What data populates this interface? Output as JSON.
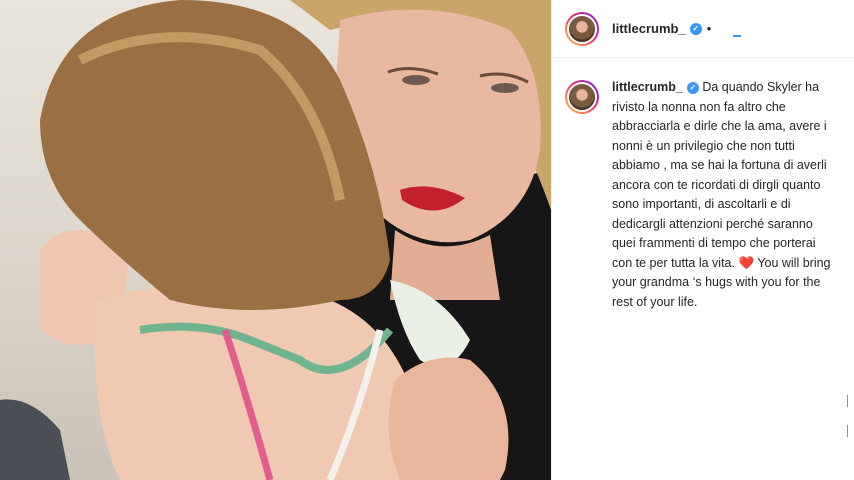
{
  "post": {
    "username": "littlecrumb_",
    "verified_mark": "✓",
    "separator": "•",
    "caption_main": "Da quando Skyler ha rivisto la nonna non fa altro che abbracciarla e dirle che la ama, avere i nonni è un privilegio che non tutti abbiamo , ma se hai la fortuna di averli ancora con te ricordati di dirgli quanto sono importanti, di ascoltarli e di dedicargli attenzioni perché saranno quei frammenti di tempo che porterai con te per tutta la vita.",
    "caption_emoji": "❤️",
    "caption_end": "You will bring your grandma ‘s hugs with you for the rest of your life."
  },
  "icons": {
    "verified": "verified-badge-icon",
    "heart": "red-heart-emoji"
  },
  "colors": {
    "accent": "#3897f0",
    "text": "#262626",
    "heart": "#ed4956",
    "divider": "#efefef"
  }
}
